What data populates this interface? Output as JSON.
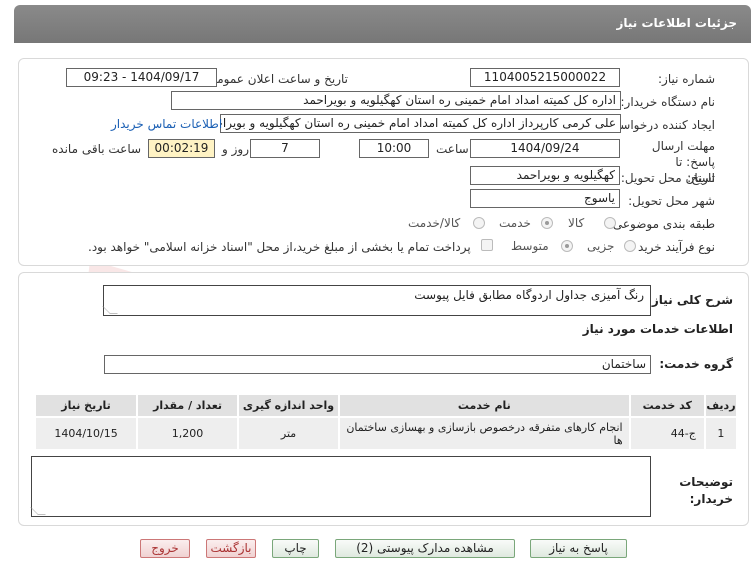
{
  "header": {
    "title": "جزئیات اطلاعات نیاز"
  },
  "form": {
    "need_number_label": "شماره نیاز:",
    "need_number": "1104005215000022",
    "announce_label": "تاریخ و ساعت اعلان عمومی:",
    "announce_value": "1404/09/17 - 09:23",
    "buyer_org_label": "نام دستگاه خریدار:",
    "buyer_org": "اداره کل کمیته امداد امام خمینی  ره  استان کهگیلویه و بویراحمد",
    "creator_label": "ایجاد کننده درخواست:",
    "creator": "علی کرمی کارپرداز اداره کل کمیته امداد امام خمینی  ره  استان کهگیلویه و بویراحمد",
    "contact_link": "اطلاعات تماس خریدار",
    "deadline_label": "مهلت ارسال پاسخ: تا تاریخ:",
    "deadline_date": "1404/09/24",
    "time_label": "ساعت",
    "deadline_time": "10:00",
    "days_value": "7",
    "days_label": "روز و",
    "remaining_time": "00:02:19",
    "remaining_label": "ساعت باقی مانده",
    "province_label": "استان محل تحویل:",
    "province": "کهگیلویه و بویراحمد",
    "city_label": "شهر محل تحویل:",
    "city": "یاسوج",
    "category_label": "طبقه بندی موضوعی:",
    "category_options": [
      "کالا",
      "خدمت",
      "کالا/خدمت"
    ],
    "process_label": "نوع فرآیند خرید :",
    "process_options": [
      "جزیی",
      "متوسط"
    ],
    "payment_note": "پرداخت تمام یا بخشی از مبلغ خرید،از محل \"اسناد خزانه اسلامی\" خواهد بود."
  },
  "details": {
    "summary_label": "شرح کلی نیاز:",
    "summary": "رنگ آمیزی جداول اردوگاه مطابق فایل پیوست",
    "services_title": "اطلاعات خدمات مورد نیاز",
    "service_group_label": "گروه خدمت:",
    "service_group": "ساختمان",
    "table": {
      "columns": [
        "ردیف",
        "کد خدمت",
        "نام خدمت",
        "واحد اندازه گیری",
        "تعداد / مقدار",
        "تاریخ نیاز"
      ],
      "rows": [
        [
          "1",
          "ج-44",
          "انجام کارهای متفرقه درخصوص بازسازی و بهسازی ساختمان ها",
          "متر",
          "1,200",
          "1404/10/15"
        ]
      ]
    },
    "buyer_notes_label": "توضیحات خریدار:",
    "buyer_notes": ""
  },
  "buttons": {
    "respond": "پاسخ به نیاز",
    "view_docs": "مشاهده مدارک پیوستی (2)",
    "print": "چاپ",
    "back": "بازگشت",
    "exit": "خروج"
  },
  "watermark_text": "AriaTender.net"
}
